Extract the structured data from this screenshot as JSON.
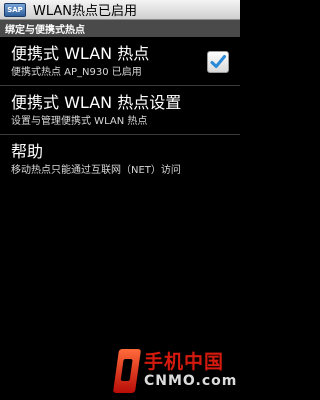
{
  "statusbar": {
    "badge": "SAP",
    "title": "WLAN热点已启用"
  },
  "section": {
    "header": "绑定与便携式热点"
  },
  "items": [
    {
      "title": "便携式 WLAN 热点",
      "subtitle": "便携式热点 AP_N930 已启用",
      "checked": true
    },
    {
      "title": "便携式 WLAN 热点设置",
      "subtitle": "设置与管理便携式 WLAN 热点"
    },
    {
      "title": "帮助",
      "subtitle": "移动热点只能通过互联网（NET）访问"
    }
  ],
  "watermark": {
    "cn": "手机中国",
    "en": "CNMO.com"
  },
  "colors": {
    "background": "#000000",
    "checkmark": "#2a8ad8",
    "section_header": "#4a4a4a",
    "watermark_red": "#d41a0e"
  }
}
